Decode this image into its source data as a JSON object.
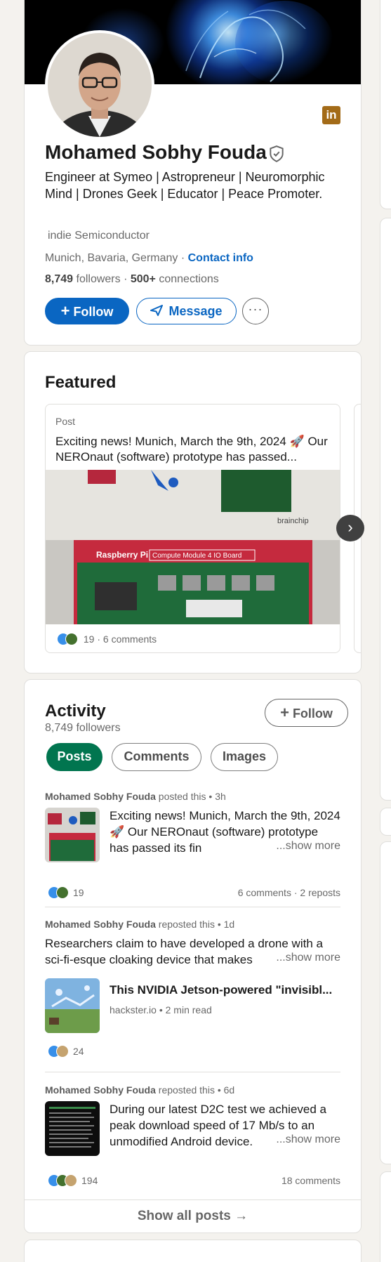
{
  "profile": {
    "name": "Mohamed Sobhy Fouda",
    "headline": "Engineer at Symeo | Astropreneur | Neuromorphic Mind | Drones Geek | Educator | Peace Promoter.",
    "company": "indie Semiconductor",
    "location": "Munich, Bavaria, Germany",
    "location_sep": " · ",
    "contact_info": "Contact info",
    "followers_count": "8,749",
    "followers_label": "followers",
    "connections_sep": "  · ",
    "connections_count": "500+",
    "connections_label": "connections",
    "follow_label": "Follow",
    "message_label": "Message",
    "more_label": "···",
    "linkedin_badge": "in"
  },
  "featured": {
    "title": "Featured",
    "item": {
      "kind": "Post",
      "text": "Exciting news! Munich, March the 9th, 2024 🚀 Our NEROnaut (software) prototype has passed...",
      "image_text_brand": "brainchip",
      "image_text_board": "Raspberry Pi",
      "image_text_module": "Compute Module 4 IO Board",
      "reaction_count": "19",
      "comments": "6 comments"
    },
    "next_label": "›"
  },
  "activity": {
    "title": "Activity",
    "followers": "8,749 followers",
    "follow_label": "Follow",
    "tabs": [
      {
        "label": "Posts",
        "active": true
      },
      {
        "label": "Comments",
        "active": false
      },
      {
        "label": "Images",
        "active": false
      }
    ],
    "posts": [
      {
        "author": "Mohamed Sobhy Fouda",
        "action": "posted this",
        "time": "3h",
        "text": "Exciting news! Munich, March the 9th, 2024 🚀 Our NEROnaut (software) prototype has passed its fin",
        "show_more": "...show more",
        "reactions": "19",
        "comments": "6 comments",
        "reposts": "2 reposts"
      },
      {
        "author": "Mohamed Sobhy Fouda",
        "action": "reposted this",
        "time": "1d",
        "text": "Researchers claim to have developed a drone with a sci-fi-esque cloaking device that makes",
        "show_more": "...show more",
        "article_title": "This NVIDIA Jetson-powered \"invisibl...",
        "article_source": "hackster.io",
        "article_read": "2 min read",
        "reactions": "24"
      },
      {
        "author": "Mohamed Sobhy Fouda",
        "action": "reposted this",
        "time": "6d",
        "text": "During our latest D2C test we achieved a peak download speed of 17 Mb/s to an unmodified Android device.",
        "show_more": "...show more",
        "reactions": "194",
        "comments": "18 comments"
      }
    ],
    "show_all": "Show all posts →"
  },
  "colors": {
    "brand_blue": "#0a66c2",
    "active_green": "#01754f",
    "background": "#f4f2ee"
  },
  "icons": [
    "linkedin-icon",
    "verified-icon",
    "plus-icon",
    "send-icon",
    "more-icon",
    "chevron-right-icon",
    "like-icon",
    "clap-icon",
    "support-icon",
    "arrow-right-icon"
  ]
}
